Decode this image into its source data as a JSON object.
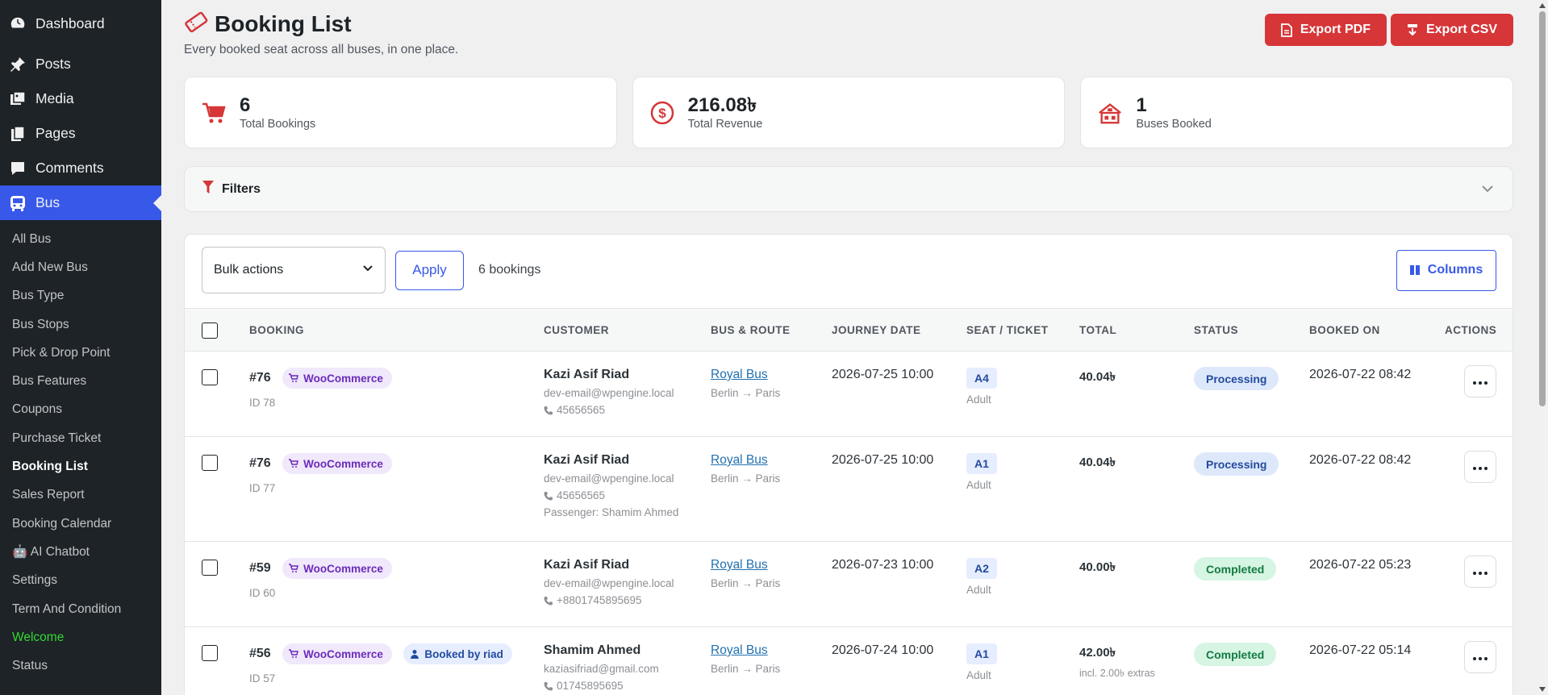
{
  "sidebar": {
    "top_items": [
      {
        "label": "Dashboard",
        "icon": "dashboard-icon"
      },
      {
        "label": "Posts",
        "icon": "pin-icon"
      },
      {
        "label": "Media",
        "icon": "media-icon"
      },
      {
        "label": "Pages",
        "icon": "pages-icon"
      },
      {
        "label": "Comments",
        "icon": "comment-icon"
      },
      {
        "label": "Bus",
        "icon": "bus-icon"
      }
    ],
    "sub_items": [
      {
        "label": "All Bus"
      },
      {
        "label": "Add New Bus"
      },
      {
        "label": "Bus Type"
      },
      {
        "label": "Bus Stops"
      },
      {
        "label": "Pick & Drop Point"
      },
      {
        "label": "Bus Features"
      },
      {
        "label": "Coupons"
      },
      {
        "label": "Purchase Ticket"
      },
      {
        "label": "Booking List"
      },
      {
        "label": "Sales Report"
      },
      {
        "label": "Booking Calendar"
      },
      {
        "label": "🤖 AI Chatbot"
      },
      {
        "label": "Settings"
      },
      {
        "label": "Term And Condition"
      },
      {
        "label": "Welcome"
      },
      {
        "label": "Status"
      }
    ]
  },
  "header": {
    "title": "Booking List",
    "subtitle": "Every booked seat across all buses, in one place.",
    "export_pdf": "Export PDF",
    "export_csv": "Export CSV"
  },
  "stats": [
    {
      "value": "6",
      "label": "Total Bookings",
      "icon": "cart-icon"
    },
    {
      "value": "216.08৳",
      "label": "Total Revenue",
      "icon": "dollar-icon"
    },
    {
      "value": "1",
      "label": "Buses Booked",
      "icon": "buildings-icon"
    }
  ],
  "filters": {
    "label": "Filters"
  },
  "toolbar": {
    "bulk_actions": "Bulk actions",
    "apply": "Apply",
    "count": "6 bookings",
    "columns": "Columns"
  },
  "table": {
    "headers": [
      "BOOKING",
      "CUSTOMER",
      "BUS & ROUTE",
      "JOURNEY DATE",
      "SEAT / TICKET",
      "TOTAL",
      "STATUS",
      "BOOKED ON",
      "ACTIONS"
    ],
    "rows": [
      {
        "booking": "#76",
        "source": "WooCommerce",
        "id": "ID 78",
        "customer": "Kazi Asif Riad",
        "email": "dev-email@wpengine.local",
        "phone": "45656565",
        "bus": "Royal Bus",
        "route": "Berlin → Paris",
        "journey": "2026-07-25 10:00",
        "seat": "A4",
        "ticket": "Adult",
        "total": "40.04৳",
        "status": "Processing",
        "booked_on": "2026-07-22 08:42"
      },
      {
        "booking": "#76",
        "source": "WooCommerce",
        "id": "ID 77",
        "customer": "Kazi Asif Riad",
        "email": "dev-email@wpengine.local",
        "phone": "45656565",
        "passenger": "Passenger: Shamim Ahmed",
        "bus": "Royal Bus",
        "route": "Berlin → Paris",
        "journey": "2026-07-25 10:00",
        "seat": "A1",
        "ticket": "Adult",
        "total": "40.04৳",
        "status": "Processing",
        "booked_on": "2026-07-22 08:42"
      },
      {
        "booking": "#59",
        "source": "WooCommerce",
        "id": "ID 60",
        "customer": "Kazi Asif Riad",
        "email": "dev-email@wpengine.local",
        "phone": "+8801745895695",
        "bus": "Royal Bus",
        "route": "Berlin → Paris",
        "journey": "2026-07-23 10:00",
        "seat": "A2",
        "ticket": "Adult",
        "total": "40.00৳",
        "status": "Completed",
        "booked_on": "2026-07-22 05:23"
      },
      {
        "booking": "#56",
        "source": "WooCommerce",
        "booked_by": "Booked by riad",
        "id": "ID 57",
        "customer": "Shamim Ahmed",
        "email": "kaziasifriad@gmail.com",
        "phone": "01745895695",
        "bus": "Royal Bus",
        "route": "Berlin → Paris",
        "journey": "2026-07-24 10:00",
        "seat": "A1",
        "ticket": "Adult",
        "total": "42.00৳",
        "extras": "incl. 2.00৳ extras",
        "status": "Completed",
        "booked_on": "2026-07-22 05:14"
      }
    ]
  },
  "colors": {
    "accent": "#3858e9",
    "danger": "#d63638",
    "sidebar": "#1d2327"
  }
}
